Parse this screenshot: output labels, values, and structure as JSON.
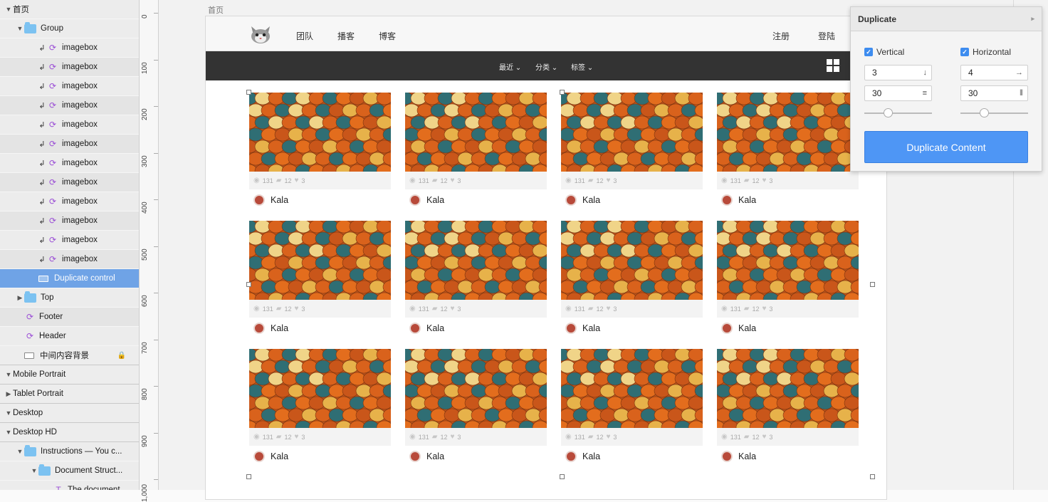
{
  "layers": {
    "items": [
      {
        "label": "首页",
        "depth": 0,
        "kind": "page",
        "tri": "open"
      },
      {
        "label": "Group",
        "depth": 1,
        "kind": "folder",
        "tri": "open"
      },
      {
        "label": "imagebox",
        "depth": 2,
        "kind": "symbol"
      },
      {
        "label": "imagebox",
        "depth": 2,
        "kind": "symbol"
      },
      {
        "label": "imagebox",
        "depth": 2,
        "kind": "symbol"
      },
      {
        "label": "imagebox",
        "depth": 2,
        "kind": "symbol"
      },
      {
        "label": "imagebox",
        "depth": 2,
        "kind": "symbol"
      },
      {
        "label": "imagebox",
        "depth": 2,
        "kind": "symbol"
      },
      {
        "label": "imagebox",
        "depth": 2,
        "kind": "symbol"
      },
      {
        "label": "imagebox",
        "depth": 2,
        "kind": "symbol"
      },
      {
        "label": "imagebox",
        "depth": 2,
        "kind": "symbol"
      },
      {
        "label": "imagebox",
        "depth": 2,
        "kind": "symbol"
      },
      {
        "label": "imagebox",
        "depth": 2,
        "kind": "symbol"
      },
      {
        "label": "imagebox",
        "depth": 2,
        "kind": "symbol"
      },
      {
        "label": "Duplicate control",
        "depth": 2,
        "kind": "rect",
        "selected": true
      },
      {
        "label": "Top",
        "depth": 1,
        "kind": "folder",
        "tri": "closed"
      },
      {
        "label": "Footer",
        "depth": 1,
        "kind": "symbol-only"
      },
      {
        "label": "Header",
        "depth": 1,
        "kind": "symbol-only"
      },
      {
        "label": "中间内容背景",
        "depth": 1,
        "kind": "rect",
        "locked": true
      },
      {
        "label": "Mobile Portrait",
        "depth": 0,
        "kind": "page",
        "tri": "open"
      },
      {
        "label": "Tablet Portrait",
        "depth": 0,
        "kind": "page",
        "tri": "closed"
      },
      {
        "label": "Desktop",
        "depth": 0,
        "kind": "page",
        "tri": "open"
      },
      {
        "label": "Desktop HD",
        "depth": 0,
        "kind": "page",
        "tri": "open"
      },
      {
        "label": "Instructions — You c...",
        "depth": 1,
        "kind": "folder-edit",
        "tri": "open"
      },
      {
        "label": "Document Struct...",
        "depth": 2,
        "kind": "folder",
        "tri": "open"
      },
      {
        "label": "The document",
        "depth": 3,
        "kind": "text"
      }
    ]
  },
  "ruler": {
    "labels": [
      "0",
      "100",
      "200",
      "300",
      "400",
      "500",
      "600",
      "700",
      "800",
      "900",
      "1,000"
    ]
  },
  "artboard": {
    "name": "首页"
  },
  "site": {
    "nav_left": [
      "团队",
      "播客",
      "博客"
    ],
    "nav_right": [
      "注册",
      "登陆"
    ],
    "categories": [
      "最近",
      "分类",
      "标签"
    ]
  },
  "card": {
    "views": "131",
    "comments": "12",
    "likes": "3",
    "author": "Kala",
    "count": 12
  },
  "duplicate_panel": {
    "title": "Duplicate",
    "vertical_label": "Vertical",
    "horizontal_label": "Horizontal",
    "vertical_count": "3",
    "horizontal_count": "4",
    "vertical_spacing": "30",
    "horizontal_spacing": "30",
    "vertical_slider_value": 0.33,
    "horizontal_slider_value": 0.33,
    "button_label": "Duplicate Content",
    "accent": "#4e96f5"
  }
}
